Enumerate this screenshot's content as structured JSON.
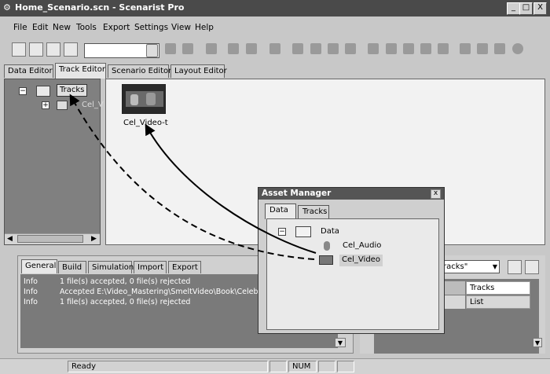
{
  "window": {
    "title": "Home_Scenario.scn - Scenarist Pro",
    "min_btn": "_",
    "max_btn": "□",
    "close_btn": "X"
  },
  "menu": [
    "File",
    "Edit",
    "New",
    "Tools",
    "Export",
    "Settings",
    "View",
    "Help"
  ],
  "editor_tabs": [
    {
      "label": "Data Editor",
      "active": false
    },
    {
      "label": "Track Editor",
      "active": true
    },
    {
      "label": "Scenario Editor",
      "active": false
    },
    {
      "label": "Layout Editor",
      "active": false
    }
  ],
  "tree": {
    "root_label": "Tracks",
    "child_label": "Cel_V",
    "collapse": "−",
    "expand": "+"
  },
  "canvas": {
    "thumb_label": "Cel_Video-t"
  },
  "output": {
    "tabs": [
      "General",
      "Build",
      "Simulation",
      "Import",
      "Export"
    ],
    "rows": [
      {
        "level": "Info",
        "message": "1 file(s) accepted, 0 file(s) rejected"
      },
      {
        "level": "Info",
        "message": "Accepted E:\\Video_Mastering\\SmeltVideo\\Book\\Celebra"
      },
      {
        "level": "Info",
        "message": "1 file(s) accepted, 0 file(s) rejected"
      }
    ]
  },
  "properties": {
    "combo_value": "racks\"",
    "cell1": "Tracks",
    "cell2": "List"
  },
  "status": {
    "ready": "Ready",
    "num": "NUM"
  },
  "asset_manager": {
    "title": "Asset Manager",
    "close": "x",
    "tabs": [
      {
        "label": "Data",
        "active": true
      },
      {
        "label": "Tracks",
        "active": false
      }
    ],
    "root": "Data",
    "items": [
      "Cel_Audio",
      "Cel_Video"
    ]
  }
}
